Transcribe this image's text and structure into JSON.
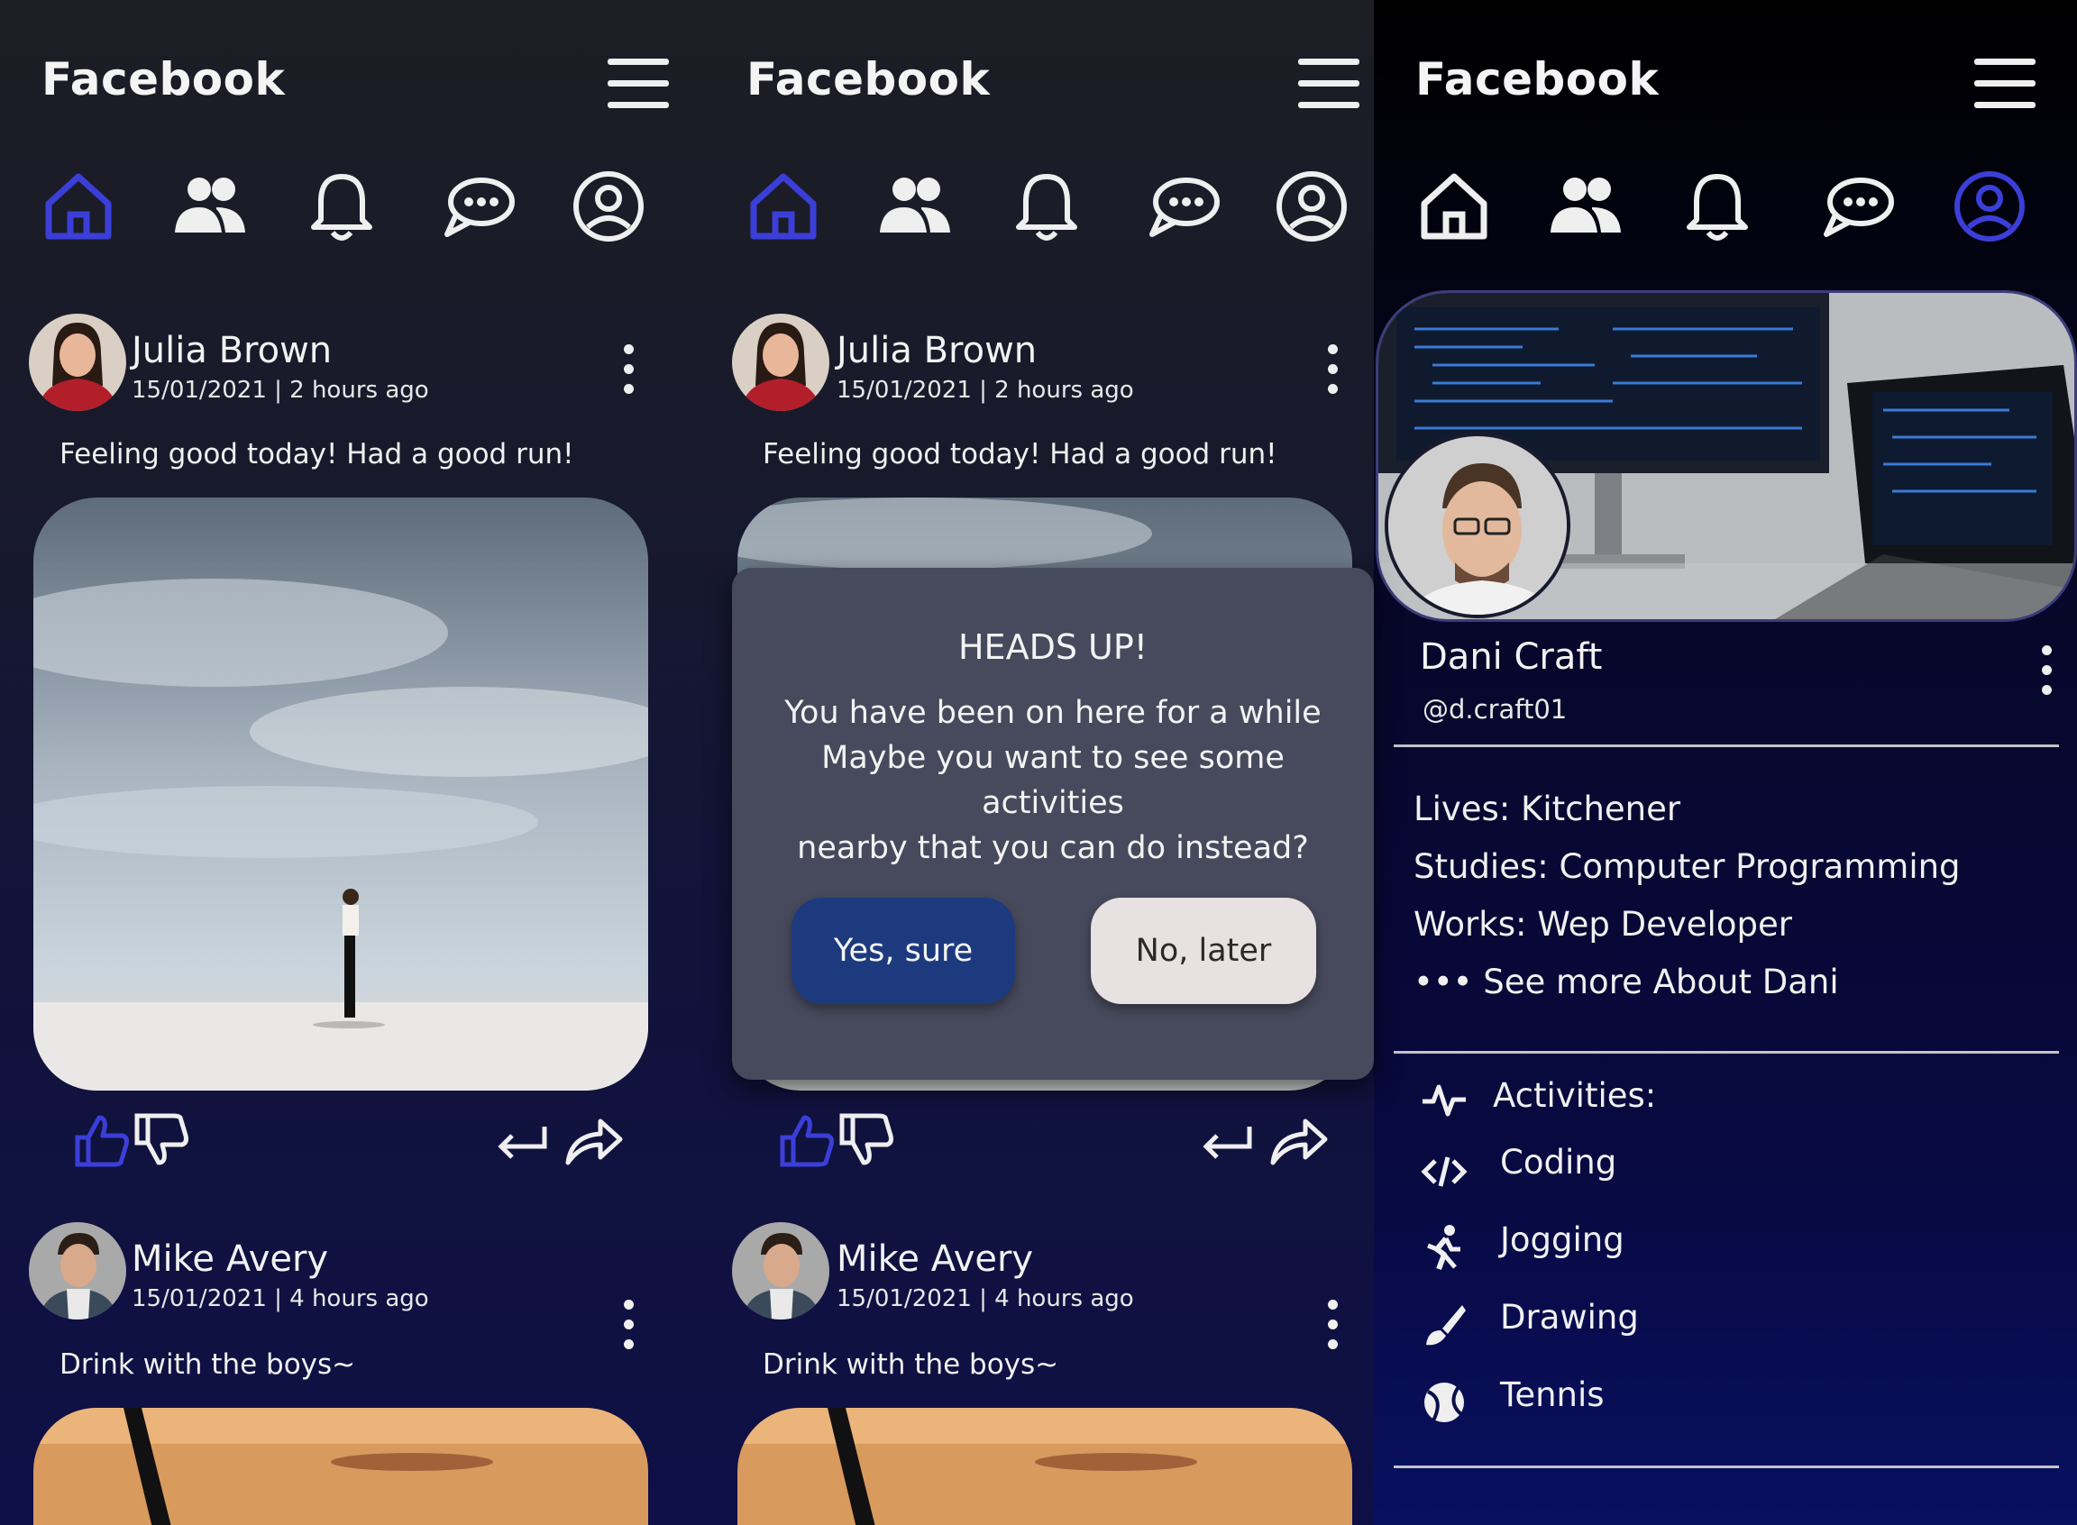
{
  "app": {
    "brand": "Facebook"
  },
  "colors": {
    "accent": "#3b3fd8",
    "icon": "#efefef",
    "modal_bg": "#474a5c",
    "yes_btn": "#1d3a7f",
    "no_btn": "#e7e1e1"
  },
  "nav": {
    "icons": [
      "home-icon",
      "friends-icon",
      "bell-icon",
      "chat-icon",
      "profile-icon"
    ]
  },
  "feed": {
    "posts": [
      {
        "author": "Julia Brown",
        "meta": "15/01/2021 | 2 hours ago",
        "text": "Feeling good today! Had a good run!"
      },
      {
        "author": "Mike Avery",
        "meta": "15/01/2021 | 4 hours ago",
        "text": "Drink with the boys~"
      }
    ]
  },
  "modal": {
    "title": "HEADS UP!",
    "line1": "You have been on here for a while",
    "line2": "Maybe you want to see some activities",
    "line3": "nearby that you can do instead?",
    "yes_label": "Yes, sure",
    "no_label": "No, later"
  },
  "profile": {
    "name": "Dani Craft",
    "handle": "@d.craft01",
    "lives": "Lives: Kitchener",
    "studies": "Studies: Computer Programming",
    "works": "Works: Wep Developer",
    "see_more": "••• See more About Dani",
    "activities_label": "Activities:",
    "activities": [
      "Coding",
      "Jogging",
      "Drawing",
      "Tennis"
    ]
  }
}
